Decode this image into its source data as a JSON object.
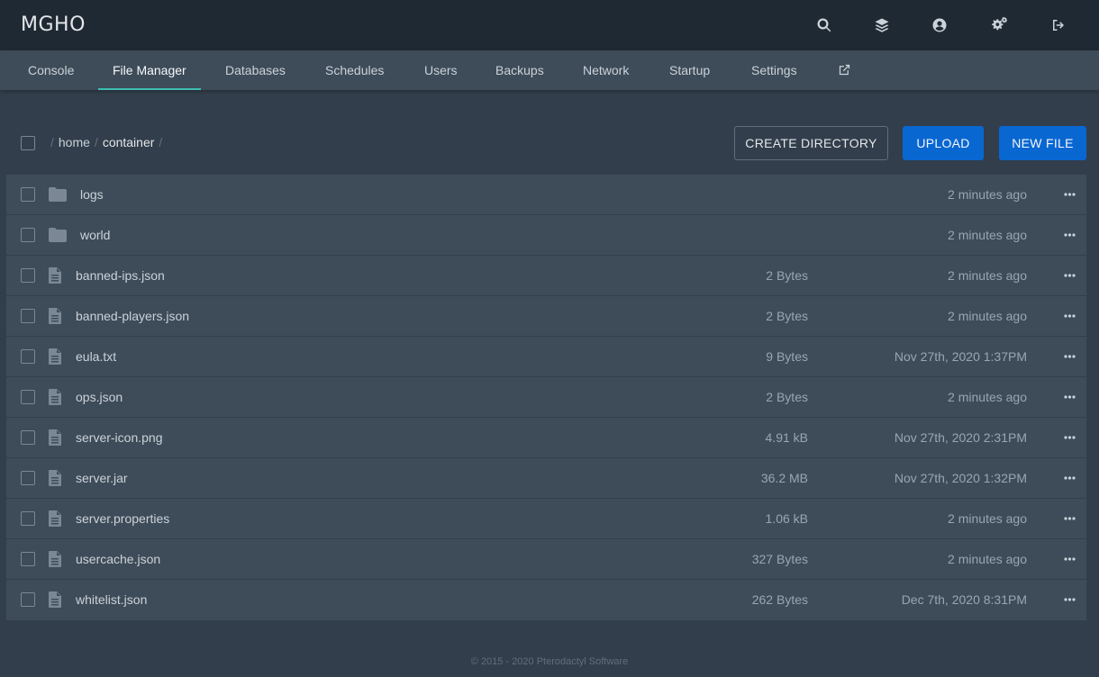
{
  "app": {
    "title": "MGHO",
    "colors": {
      "topbar": "#1f2933",
      "subnav": "#3e4c59",
      "background": "#323e4b",
      "accent": "#3ebdb3",
      "primary": "#0967d2"
    }
  },
  "topbar": {
    "icons": [
      "search-icon",
      "layers-icon",
      "user-circle-icon",
      "cogs-icon",
      "sign-out-icon"
    ]
  },
  "nav": {
    "tabs": [
      {
        "label": "Console"
      },
      {
        "label": "File Manager",
        "active": true
      },
      {
        "label": "Databases"
      },
      {
        "label": "Schedules"
      },
      {
        "label": "Users"
      },
      {
        "label": "Backups"
      },
      {
        "label": "Network"
      },
      {
        "label": "Startup"
      },
      {
        "label": "Settings"
      }
    ],
    "external_icon": "external-link-icon"
  },
  "toolbar": {
    "breadcrumb": [
      "home",
      "container"
    ],
    "create_directory_label": "CREATE DIRECTORY",
    "upload_label": "UPLOAD",
    "new_file_label": "NEW FILE"
  },
  "files": [
    {
      "name": "logs",
      "type": "directory",
      "size": "",
      "modified": "2 minutes ago"
    },
    {
      "name": "world",
      "type": "directory",
      "size": "",
      "modified": "2 minutes ago"
    },
    {
      "name": "banned-ips.json",
      "type": "file",
      "size": "2 Bytes",
      "modified": "2 minutes ago"
    },
    {
      "name": "banned-players.json",
      "type": "file",
      "size": "2 Bytes",
      "modified": "2 minutes ago"
    },
    {
      "name": "eula.txt",
      "type": "file",
      "size": "9 Bytes",
      "modified": "Nov 27th, 2020 1:37PM"
    },
    {
      "name": "ops.json",
      "type": "file",
      "size": "2 Bytes",
      "modified": "2 minutes ago"
    },
    {
      "name": "server-icon.png",
      "type": "file",
      "size": "4.91 kB",
      "modified": "Nov 27th, 2020 2:31PM"
    },
    {
      "name": "server.jar",
      "type": "file",
      "size": "36.2 MB",
      "modified": "Nov 27th, 2020 1:32PM"
    },
    {
      "name": "server.properties",
      "type": "file",
      "size": "1.06 kB",
      "modified": "2 minutes ago"
    },
    {
      "name": "usercache.json",
      "type": "file",
      "size": "327 Bytes",
      "modified": "2 minutes ago"
    },
    {
      "name": "whitelist.json",
      "type": "file",
      "size": "262 Bytes",
      "modified": "Dec 7th, 2020 8:31PM"
    }
  ],
  "footer": {
    "text": "© 2015 - 2020 Pterodactyl Software"
  }
}
